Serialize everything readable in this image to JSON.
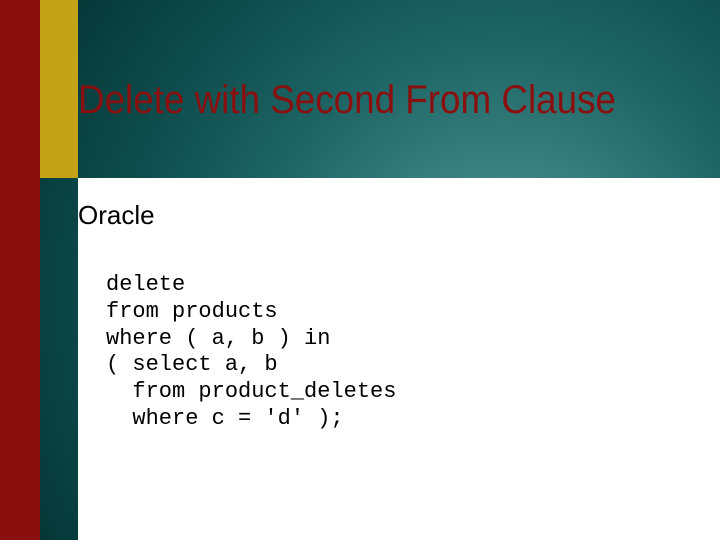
{
  "title": "Delete with Second From Clause",
  "subtitle": "Oracle",
  "code": "delete\nfrom products\nwhere ( a, b ) in\n( select a, b\n  from product_deletes\n  where c = 'd' );"
}
